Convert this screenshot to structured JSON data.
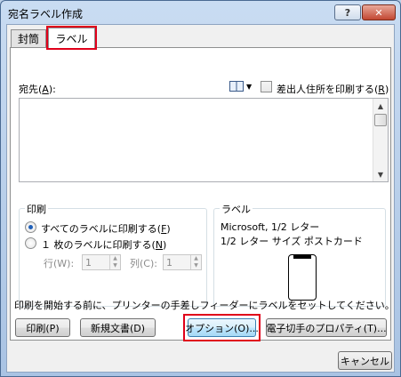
{
  "window": {
    "title": "宛名ラベル作成",
    "help": "?",
    "close": "✕"
  },
  "tabs": [
    {
      "label": "封筒"
    },
    {
      "label": "ラベル"
    }
  ],
  "address": {
    "label": "宛先(",
    "key": "A",
    "suffix": "):",
    "value": ""
  },
  "sender_checkbox": {
    "label": "差出人住所を印刷する(",
    "key": "R",
    "suffix": ")",
    "checked": false
  },
  "print_group": {
    "title": "印刷",
    "options": [
      {
        "label": "すべてのラベルに印刷する(",
        "key": "F",
        "suffix": ")",
        "checked": true
      },
      {
        "label": "１ 枚のラベルに印刷する(",
        "key": "N",
        "suffix": ")",
        "checked": false
      }
    ],
    "row_label": "行(W):",
    "row_value": "1",
    "col_label": "列(C):",
    "col_value": "1"
  },
  "label_group": {
    "title": "ラベル",
    "line1": "Microsoft, 1/2 レター",
    "line2": "1/2 レター サイズ ポストカード"
  },
  "instruction": "印刷を開始する前に、プリンターの手差しフィーダーにラベルをセットしてください。",
  "buttons": {
    "print": "印刷(P)",
    "new_document": "新規文書(D)",
    "options": "オプション(O)...",
    "e_postage": "電子切手のプロパティ(T)...",
    "cancel": "キャンセル"
  },
  "colors": {
    "highlight": "#e0001a",
    "accent": "#1f5fb8"
  }
}
